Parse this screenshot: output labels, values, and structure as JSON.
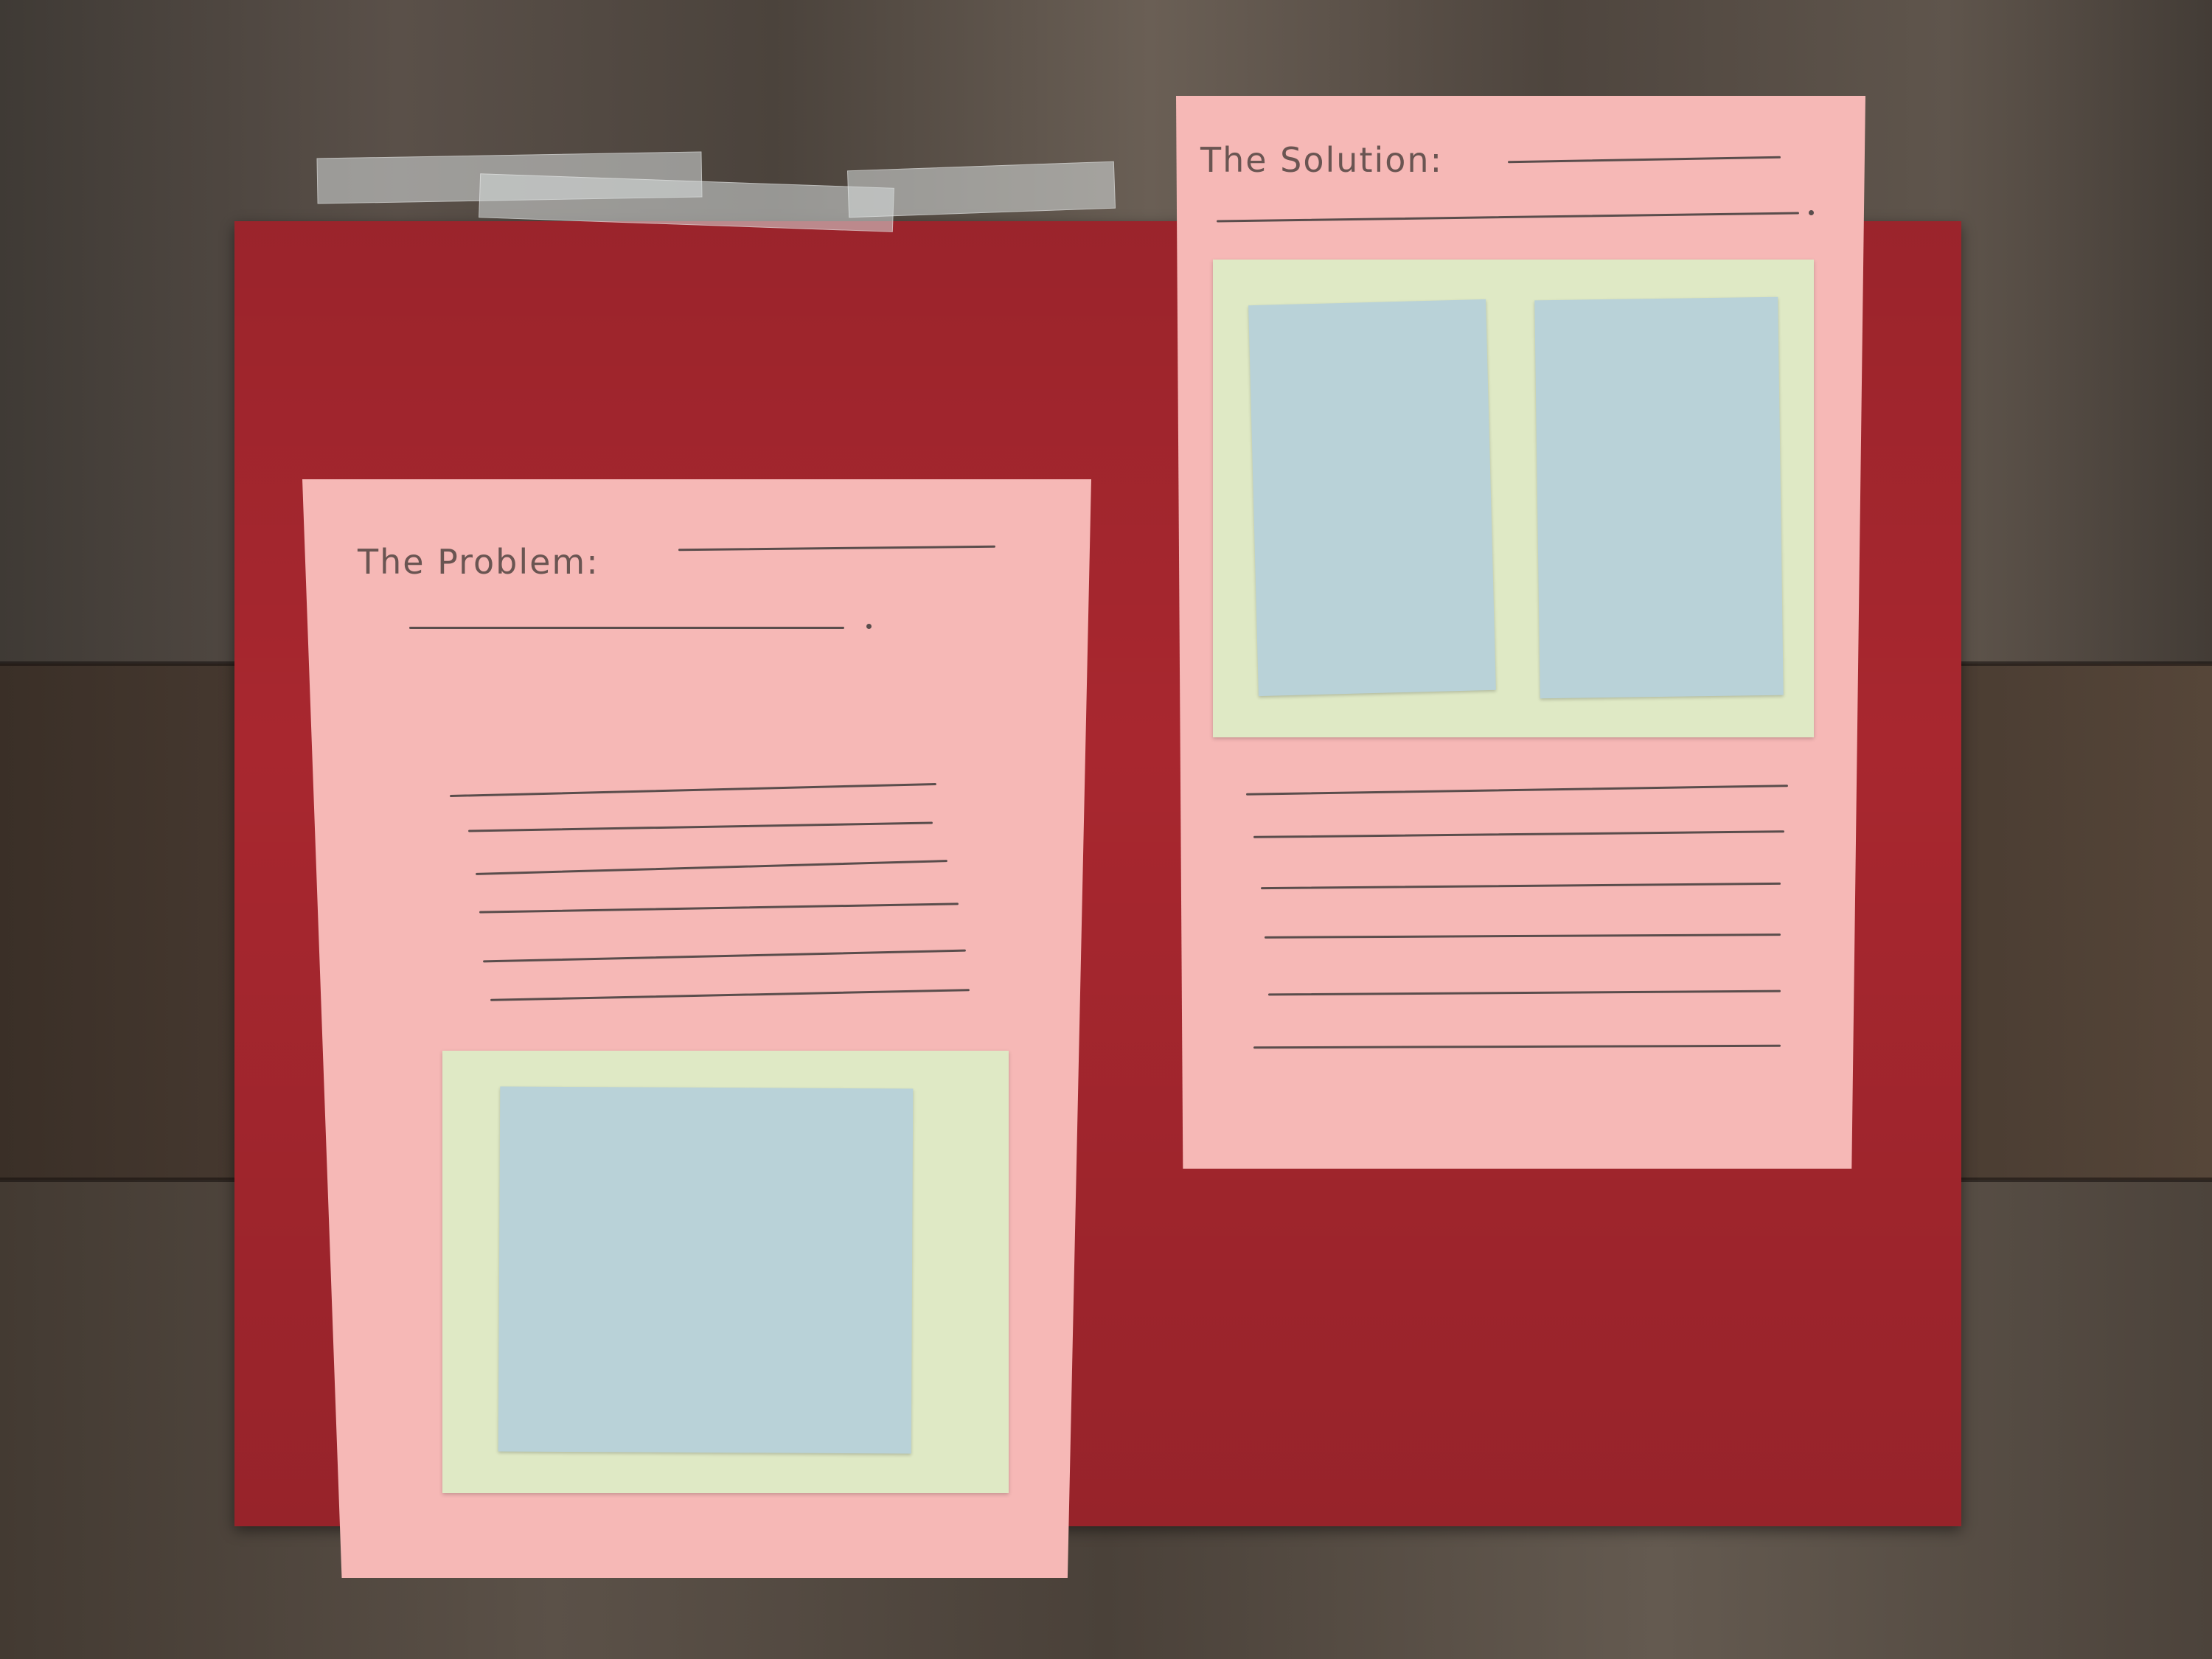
{
  "problem_sheet": {
    "heading": "The Problem:"
  },
  "solution_sheet": {
    "heading": "The Solution:"
  },
  "colors": {
    "floor": "#4a3e33",
    "poster": "#a8272f",
    "sheet": "#f6b8b6",
    "green_card": "#dfe9c5",
    "blue_card": "#b9d2d8",
    "pencil": "#5a4d4c"
  }
}
